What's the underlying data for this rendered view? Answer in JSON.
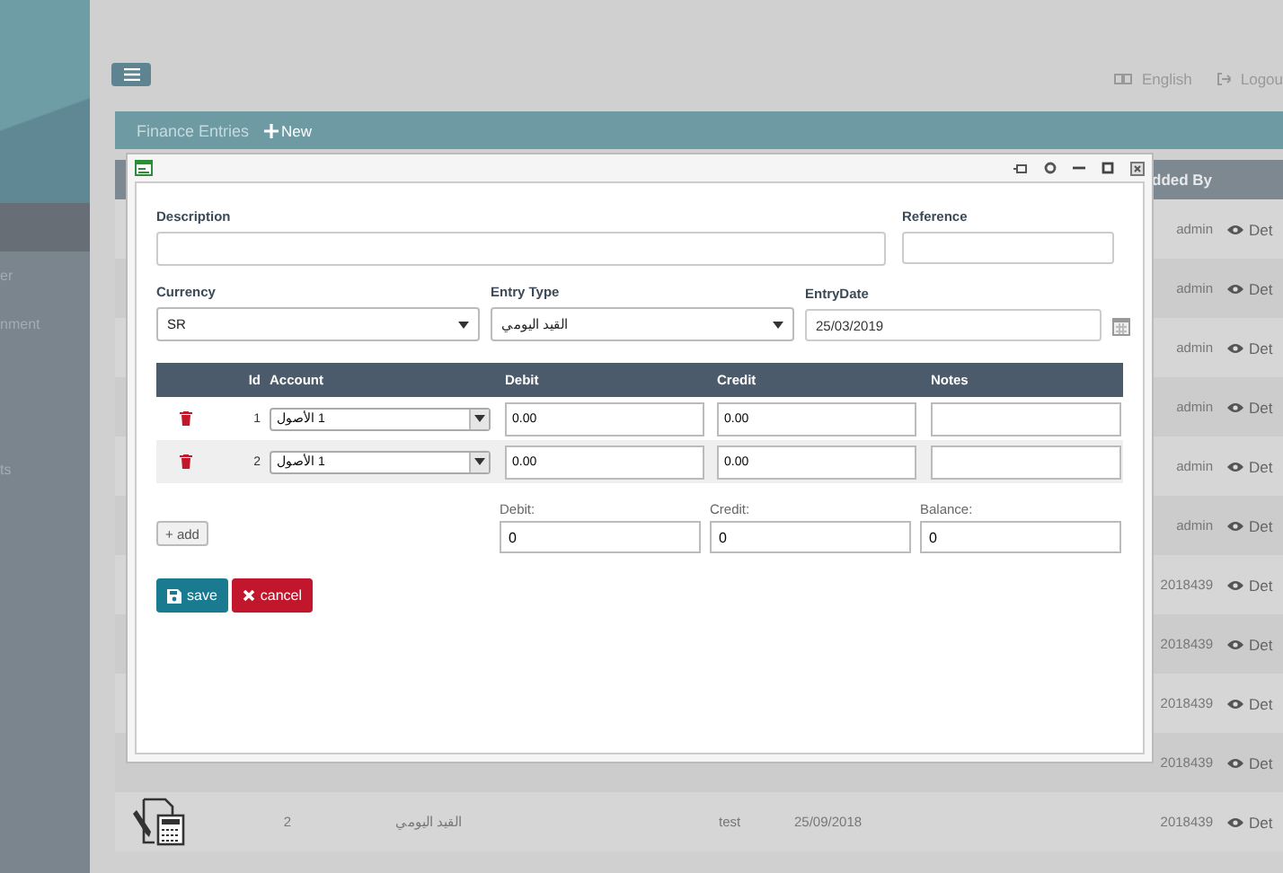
{
  "sidebar": {
    "items": [
      {
        "selected": true
      },
      {
        "label": "er",
        "selected": false
      },
      {
        "label": "nment",
        "selected": false
      },
      {
        "label": "ts",
        "selected": false
      }
    ]
  },
  "header": {
    "language": "English",
    "logout": "Logou"
  },
  "page": {
    "title": "Finance Entries",
    "new_button": "New"
  },
  "table": {
    "columns": [
      "dded By"
    ],
    "rows": [
      {
        "added_by": "admin",
        "action": "Det"
      },
      {
        "added_by": "admin",
        "action": "Det"
      },
      {
        "added_by": "admin",
        "action": "Det"
      },
      {
        "added_by": "admin",
        "action": "Det"
      },
      {
        "added_by": "admin",
        "action": "Det"
      },
      {
        "added_by": "admin",
        "action": "Det"
      },
      {
        "added_by": "2018439",
        "action": "Det"
      },
      {
        "added_by": "2018439",
        "action": "Det"
      },
      {
        "added_by": "2018439",
        "action": "Det"
      },
      {
        "added_by": "2018439",
        "action": "Det"
      },
      {
        "id": "2",
        "entry_type": "القيد اليومي",
        "description": "test",
        "date": "25/09/2018",
        "added_by": "2018439",
        "action": "Det"
      }
    ]
  },
  "dialog": {
    "description": {
      "label": "Description"
    },
    "reference": {
      "label": "Reference"
    },
    "currency": {
      "label": "Currency",
      "value": "SR"
    },
    "entry_type": {
      "label": "Entry Type",
      "value": "القيد اليومي"
    },
    "entry_date": {
      "label": "EntryDate",
      "value": "25/03/2019"
    },
    "lines": {
      "columns": [
        "Id",
        "Account",
        "Debit",
        "Credit",
        "Notes"
      ],
      "rows": [
        {
          "id": "1",
          "account": "1 الأصول",
          "debit": "0.00",
          "credit": "0.00"
        },
        {
          "id": "2",
          "account": "1 الأصول",
          "debit": "0.00",
          "credit": "0.00"
        }
      ]
    },
    "add_button": "+ add",
    "totals": [
      {
        "label": "Debit:",
        "value": "0"
      },
      {
        "label": "Credit:",
        "value": "0"
      },
      {
        "label": "Balance:",
        "value": "0"
      }
    ],
    "save_button": "save",
    "cancel_button": "cancel"
  }
}
